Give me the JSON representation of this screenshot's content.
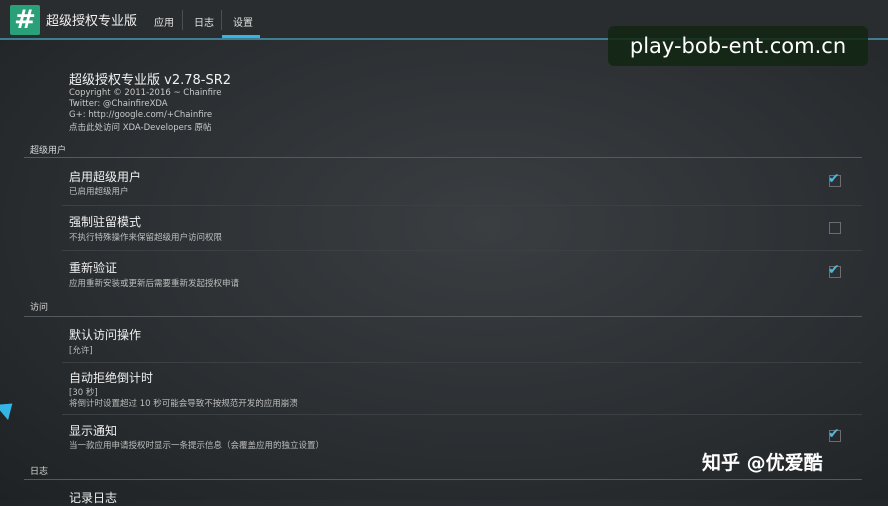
{
  "appbar": {
    "icon_glyph": "#",
    "title": "超级授权专业版",
    "tabs": [
      {
        "label": "应用"
      },
      {
        "label": "日志"
      },
      {
        "label": "设置"
      }
    ],
    "active_tab_index": 2
  },
  "watermark": "play-bob-ent.com.cn",
  "about": {
    "title": "超级授权专业版 v2.78-SR2",
    "lines": [
      "Copyright © 2011-2016 ~ Chainfire",
      "Twitter: @ChainfireXDA",
      "G+: http://google.com/+Chainfire",
      "点击此处访问 XDA-Developers 原帖"
    ]
  },
  "sections": {
    "superuser": {
      "header": "超级用户",
      "items": [
        {
          "title": "启用超级用户",
          "subtitle": "已启用超级用户",
          "checked": true
        },
        {
          "title": "强制驻留模式",
          "subtitle": "不执行特殊操作来保留超级用户访问权限",
          "checked": false
        },
        {
          "title": "重新验证",
          "subtitle": "应用重新安装或更新后需要重新发起授权申请",
          "checked": true
        }
      ]
    },
    "access": {
      "header": "访问",
      "items": [
        {
          "title": "默认访问操作",
          "subtitle": "[允许]"
        },
        {
          "title": "自动拒绝倒计时",
          "subtitle": "[30 秒]",
          "subtitle2": "将倒计时设置超过 10 秒可能会导致不按规范开发的应用崩溃"
        },
        {
          "title": "显示通知",
          "subtitle": "当一款应用申请授权时显示一条提示信息（会覆盖应用的独立设置）",
          "checked": true
        }
      ]
    },
    "log": {
      "header": "日志",
      "items": [
        {
          "title": "记录日志"
        }
      ]
    }
  },
  "zhihu_watermark": "知乎 @优爱酷",
  "colors": {
    "accent": "#33b5e5",
    "app_icon": "#2aa079",
    "background": "#2e3234"
  }
}
